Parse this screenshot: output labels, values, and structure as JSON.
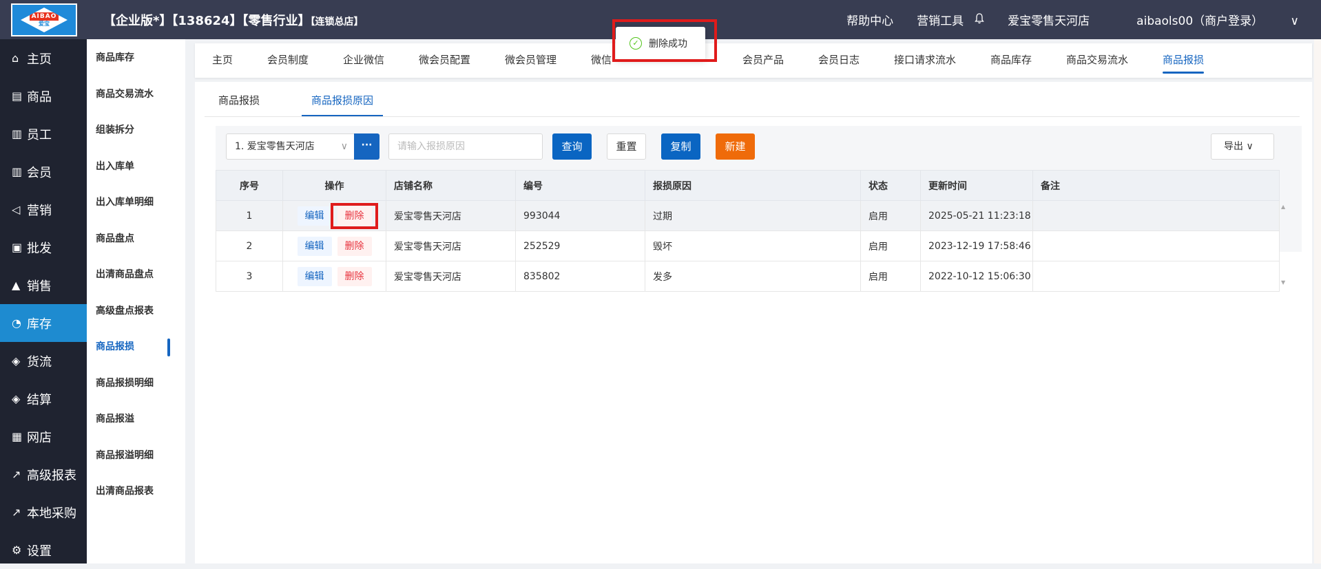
{
  "header": {
    "logo_text": "AIBAO",
    "logo_sub": "爱宝",
    "title_main": "【企业版*】【138624】【零售行业】",
    "title_small": "【连锁总店】",
    "help": "帮助中心",
    "marketing_tools": "营销工具",
    "store_name": "爱宝零售天河店",
    "user": "aibaols00（商户登录）"
  },
  "sidebar": {
    "items": [
      {
        "label": "主页",
        "icon": "home-icon"
      },
      {
        "label": "商品",
        "icon": "goods-icon"
      },
      {
        "label": "员工",
        "icon": "staff-icon"
      },
      {
        "label": "会员",
        "icon": "member-icon"
      },
      {
        "label": "营销",
        "icon": "megaphone-icon"
      },
      {
        "label": "批发",
        "icon": "wholesale-icon"
      },
      {
        "label": "销售",
        "icon": "chart-icon"
      },
      {
        "label": "库存",
        "icon": "pie-icon"
      },
      {
        "label": "货流",
        "icon": "cube-icon"
      },
      {
        "label": "结算",
        "icon": "settle-icon"
      },
      {
        "label": "网店",
        "icon": "gift-icon"
      },
      {
        "label": "高级报表",
        "icon": "trend-icon"
      },
      {
        "label": "本地采购",
        "icon": "trend-icon"
      },
      {
        "label": "设置",
        "icon": "gear-icon"
      }
    ],
    "active": "库存"
  },
  "subnav": {
    "items": [
      "商品库存",
      "商品交易流水",
      "组装拆分",
      "出入库单",
      "出入库单明细",
      "商品盘点",
      "出清商品盘点",
      "高级盘点报表",
      "商品报损",
      "商品报损明细",
      "商品报溢",
      "商品报溢明细",
      "出清商品报表"
    ],
    "active": "商品报损"
  },
  "tabs": {
    "items": [
      "主页",
      "会员制度",
      "企业微信",
      "微会员配置",
      "微会员管理",
      "微信",
      "会员产品",
      "会员日志",
      "接口请求流水",
      "商品库存",
      "商品交易流水",
      "商品报损"
    ],
    "active": "商品报损"
  },
  "subtabs": {
    "items": [
      "商品报损",
      "商品报损原因"
    ],
    "active": "商品报损原因"
  },
  "filters": {
    "store_select": "1. 爱宝零售天河店",
    "more": "···",
    "reason_placeholder": "请输入报损原因",
    "query": "查询",
    "reset": "重置",
    "copy": "复制",
    "new": "新建",
    "export": "导出"
  },
  "table": {
    "columns": [
      "序号",
      "操作",
      "店铺名称",
      "编号",
      "报损原因",
      "状态",
      "更新时间",
      "备注"
    ],
    "edit_label": "编辑",
    "delete_label": "删除",
    "rows": [
      {
        "no": "1",
        "store": "爱宝零售天河店",
        "code": "993044",
        "reason": "过期",
        "status": "启用",
        "updated": "2025-05-21 11:23:18",
        "note": ""
      },
      {
        "no": "2",
        "store": "爱宝零售天河店",
        "code": "252529",
        "reason": "毁坏",
        "status": "启用",
        "updated": "2023-12-19 17:58:46",
        "note": ""
      },
      {
        "no": "3",
        "store": "爱宝零售天河店",
        "code": "835802",
        "reason": "发多",
        "status": "启用",
        "updated": "2022-10-12 15:06:30",
        "note": ""
      }
    ]
  },
  "toast": {
    "message": "删除成功"
  },
  "colors": {
    "header_bg": "#383d52",
    "sidebar_bg": "#1f2330",
    "active_blue": "#1e8bd0",
    "primary": "#0a65c2",
    "orange": "#ef6b0a",
    "highlight_red": "#e01b1b"
  }
}
